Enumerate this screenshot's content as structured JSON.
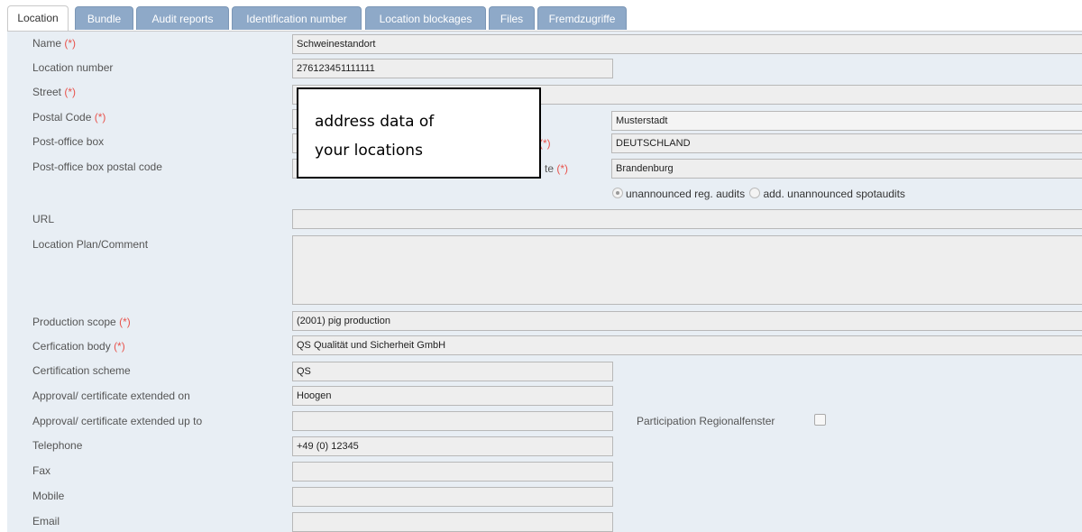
{
  "tabs": [
    "Location",
    "Bundle",
    "Audit reports",
    "Identification number",
    "Location blockages",
    "Files",
    "Fremdzugriffe"
  ],
  "required_mark": "(*)",
  "fields": {
    "name": {
      "label": "Name",
      "value": "Schweinestandort"
    },
    "location_number": {
      "label": "Location number",
      "value": "276123451111111"
    },
    "street": {
      "label": "Street",
      "value": ""
    },
    "postal_code": {
      "label": "Postal Code",
      "value": ""
    },
    "post_office_box": {
      "label": "Post-office box",
      "value": ""
    },
    "po_box_postal_code": {
      "label": "Post-office box postal code",
      "value": ""
    },
    "city": {
      "value": "Musterstadt"
    },
    "country": {
      "value": "DEUTSCHLAND"
    },
    "federal_state": {
      "label_fragment": "te",
      "value": "Brandenburg"
    },
    "url": {
      "label": "URL",
      "value": ""
    },
    "location_plan": {
      "label": "Location Plan/Comment",
      "value": ""
    },
    "production_scope": {
      "label": "Production scope",
      "value": "(2001) pig production"
    },
    "certification_body": {
      "label": "Cerfication body",
      "value": "QS Qualität und Sicherheit GmbH"
    },
    "certification_scheme": {
      "label": "Certification scheme",
      "value": "QS"
    },
    "approval_on": {
      "label": "Approval/ certificate extended on",
      "value": "Hoogen"
    },
    "approval_up_to": {
      "label": "Approval/ certificate extended up to",
      "value": ""
    },
    "regionalfenster": {
      "label": "Participation Regionalfenster",
      "checked": false
    },
    "telephone": {
      "label": "Telephone",
      "value": "+49 (0) 12345"
    },
    "fax": {
      "label": "Fax",
      "value": ""
    },
    "mobile": {
      "label": "Mobile",
      "value": ""
    },
    "email": {
      "label": "Email",
      "value": ""
    }
  },
  "audit_radio": {
    "option1": "unannounced reg. audits",
    "option2": "add. unannounced spotaudits",
    "selected": "option1"
  },
  "overlay": {
    "line1": "address data of",
    "line2": "your locations"
  }
}
